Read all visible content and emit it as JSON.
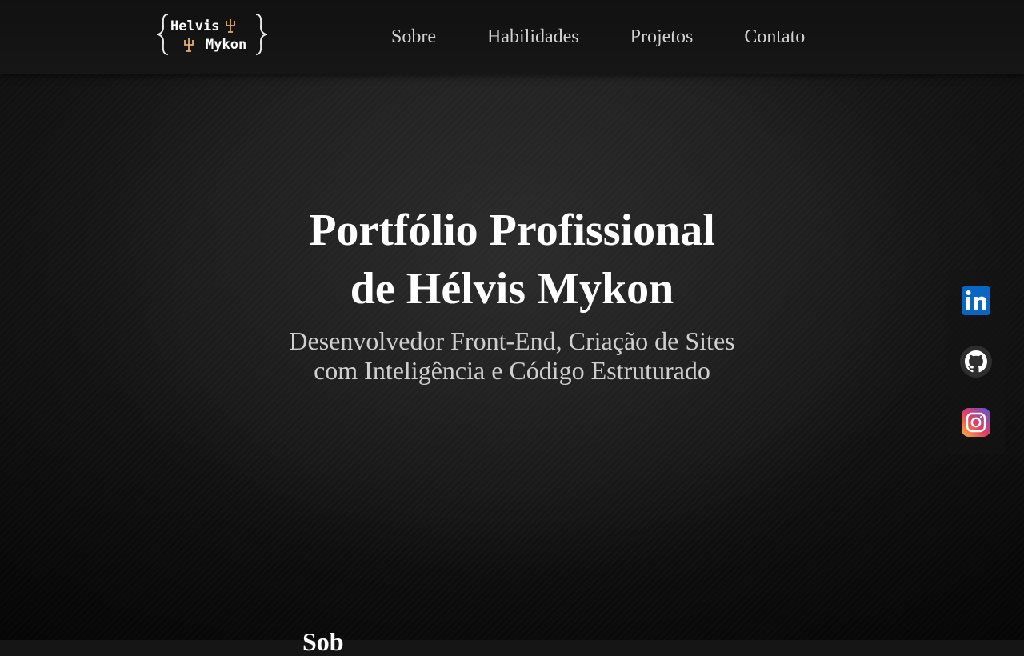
{
  "brand": {
    "logo_line1": "Helvis",
    "logo_line2": "Mykon",
    "accent_color": "#e0b070"
  },
  "nav": {
    "items": [
      {
        "label": "Sobre"
      },
      {
        "label": "Habilidades"
      },
      {
        "label": "Projetos"
      },
      {
        "label": "Contato"
      }
    ]
  },
  "hero": {
    "title_line1": "Portfólio Profissional",
    "title_line2": "de Hélvis Mykon",
    "subtitle_line1": "Desenvolvedor Front-End, Criação de Sites",
    "subtitle_line2": "com Inteligência e Código Estruturado"
  },
  "social": {
    "items": [
      {
        "name": "LinkedIn",
        "icon": "linkedin-icon",
        "color": "#0a66c2"
      },
      {
        "name": "GitHub",
        "icon": "github-icon",
        "color": "#ffffff"
      },
      {
        "name": "Instagram",
        "icon": "instagram-icon",
        "color": "#d6249f"
      }
    ]
  },
  "next_section": {
    "heading_partial": "Sob"
  }
}
